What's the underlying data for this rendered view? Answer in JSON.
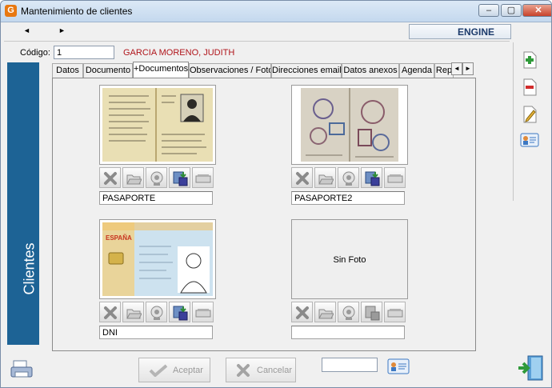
{
  "window": {
    "title": "Mantenimiento de clientes",
    "app_icon": "G",
    "minimize": "‒",
    "maximize": "▢",
    "close": "✕"
  },
  "nav": {
    "prev": "◄",
    "next": "►",
    "company": "ENGINE"
  },
  "client": {
    "code_label": "Código:",
    "code_value": "1",
    "name": "GARCIA MORENO, JUDITH"
  },
  "sidebar": {
    "label": "Clientes"
  },
  "tabs": [
    {
      "label": "Datos"
    },
    {
      "label": "Documento"
    },
    {
      "label": "+Documentos"
    },
    {
      "label": "Observaciones / Foto"
    },
    {
      "label": "Direcciones email"
    },
    {
      "label": "Datos anexos"
    },
    {
      "label": "Agenda"
    },
    {
      "label": "Rep"
    }
  ],
  "tab_scroll": {
    "left": "◄",
    "right": "►"
  },
  "documents": [
    {
      "label": "PASAPORTE",
      "has_photo": true
    },
    {
      "label": "PASAPORTE2",
      "has_photo": true
    },
    {
      "label": "DNI",
      "has_photo": true,
      "card_country": "ESPAÑA"
    },
    {
      "label": "",
      "has_photo": false,
      "placeholder": "Sin Foto"
    }
  ],
  "buttons": {
    "accept": "Aceptar",
    "cancel": "Cancelar"
  },
  "colors": {
    "sidebar": "#1d6395",
    "client_name": "#b0151b",
    "app_icon": "#e87811"
  }
}
